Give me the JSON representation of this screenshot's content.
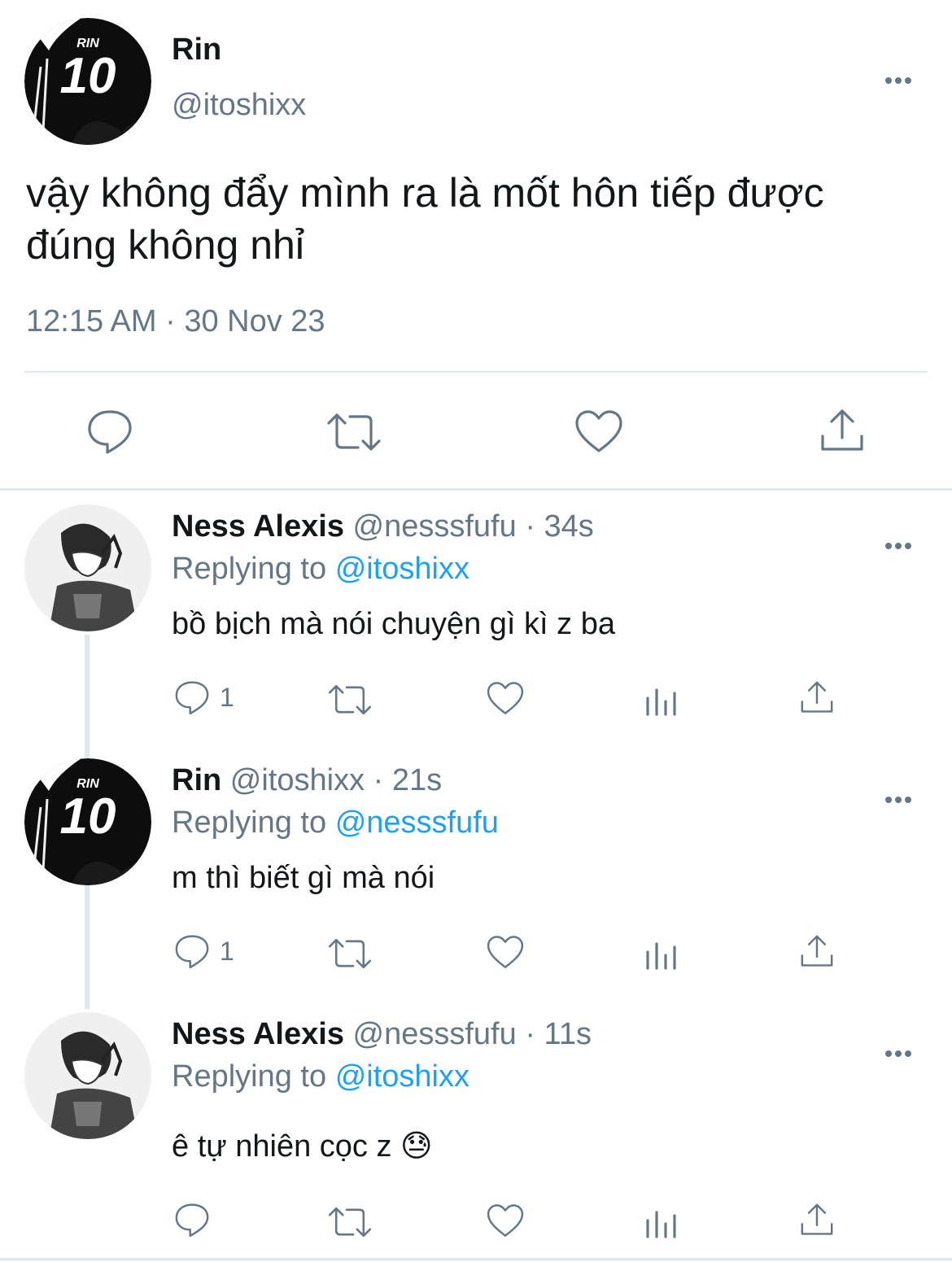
{
  "main_tweet": {
    "name": "Rin",
    "handle": "@itoshixx",
    "avatar_text": "RIN",
    "avatar_number": "10",
    "text_line1": "vậy không đẩy mình ra là mốt hôn tiếp được",
    "text_line2": "đúng không nhỉ",
    "timestamp": "12:15 AM · 30 Nov 23"
  },
  "replies": [
    {
      "name": "Ness Alexis",
      "handle": "@nesssfufu",
      "time": "· 34s",
      "replying_prefix": "Replying to",
      "replying_to": "@itoshixx",
      "text": "bồ bịch mà nói chuyện gì kì z ba",
      "reply_count": "1"
    },
    {
      "name": "Rin",
      "handle": "@itoshixx",
      "time": "· 21s",
      "replying_prefix": "Replying to",
      "replying_to": "@nesssfufu",
      "text": "m thì biết gì mà nói",
      "reply_count": "1",
      "avatar_text": "RIN",
      "avatar_number": "10"
    },
    {
      "name": "Ness Alexis",
      "handle": "@nesssfufu",
      "time": "· 11s",
      "replying_prefix": "Replying to",
      "replying_to": "@itoshixx",
      "text": "ê tự nhiên cọc z",
      "emoji": "😓",
      "reply_count": ""
    }
  ],
  "colors": {
    "accent": "#1da1f2",
    "muted": "#657786",
    "text": "#14171a",
    "divider": "#e1e8ed"
  }
}
